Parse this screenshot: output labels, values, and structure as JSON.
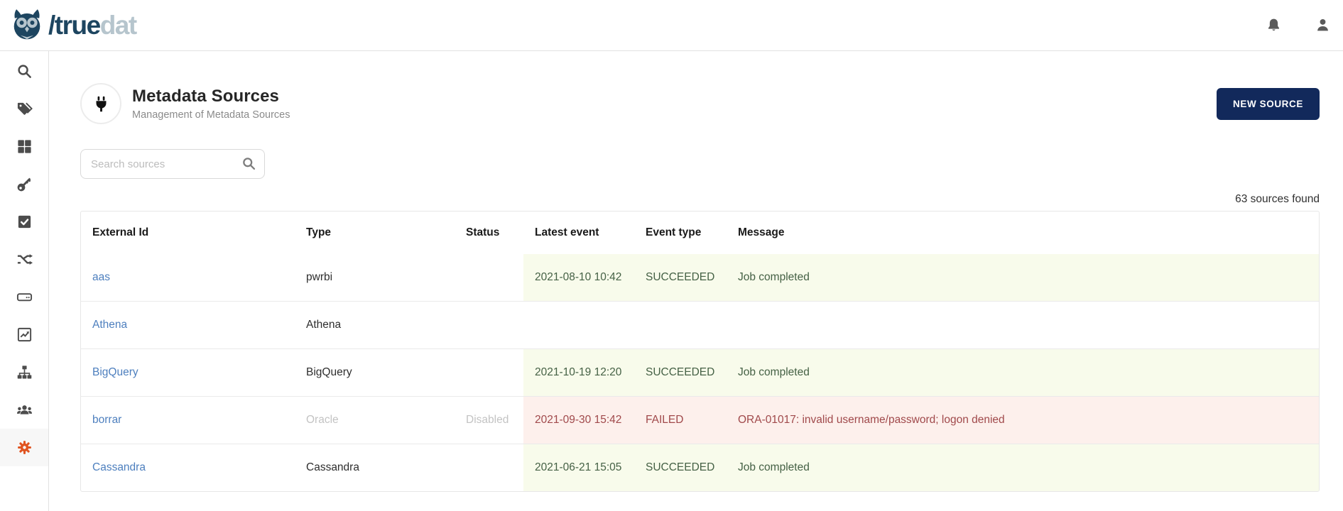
{
  "navbar": {
    "logo_text_primary": "/true",
    "logo_text_secondary": "dat",
    "right_icons": [
      "bell",
      "user"
    ]
  },
  "sidebar": {
    "icons": [
      "search",
      "tags",
      "grid",
      "key",
      "check-square",
      "shuffle",
      "hard-drive",
      "chart",
      "sitemap",
      "users",
      "gear"
    ],
    "active_icon": "gear"
  },
  "header": {
    "title": "Metadata Sources",
    "subtitle": "Management of Metadata Sources",
    "icon": "plug",
    "new_source_button": "NEW SOURCE"
  },
  "search": {
    "placeholder": "Search sources"
  },
  "results_count": "63 sources found",
  "table": {
    "columns": [
      "External Id",
      "Type",
      "Status",
      "Latest event",
      "Event type",
      "Message"
    ],
    "rows": [
      {
        "external_id": "aas",
        "type": "pwrbi",
        "status": "",
        "latest_event": "2021-08-10 10:42",
        "event_type": "SUCCEEDED",
        "message": "Job completed",
        "state": "success",
        "muted": false
      },
      {
        "external_id": "Athena",
        "type": "Athena",
        "status": "",
        "latest_event": "",
        "event_type": "",
        "message": "",
        "state": "none",
        "muted": false
      },
      {
        "external_id": "BigQuery",
        "type": "BigQuery",
        "status": "",
        "latest_event": "2021-10-19 12:20",
        "event_type": "SUCCEEDED",
        "message": "Job completed",
        "state": "success",
        "muted": false
      },
      {
        "external_id": "borrar",
        "type": "Oracle",
        "status": "Disabled",
        "latest_event": "2021-09-30 15:42",
        "event_type": "FAILED",
        "message": "ORA-01017: invalid username/password; logon denied",
        "state": "failed",
        "muted": true
      },
      {
        "external_id": "Cassandra",
        "type": "Cassandra",
        "status": "",
        "latest_event": "2021-06-21 15:05",
        "event_type": "SUCCEEDED",
        "message": "Job completed",
        "state": "success",
        "muted": false
      }
    ]
  },
  "colors": {
    "brand_dark": "#1d4560",
    "brand_light": "#b6c5cd",
    "accent_orange": "#e0531f",
    "button_navy": "#12295b",
    "link_blue": "#4d7fbe",
    "success_bg": "#f8fbeb",
    "success_text": "#456145",
    "failed_bg": "#fdf0ec",
    "failed_text": "#a0494b"
  }
}
